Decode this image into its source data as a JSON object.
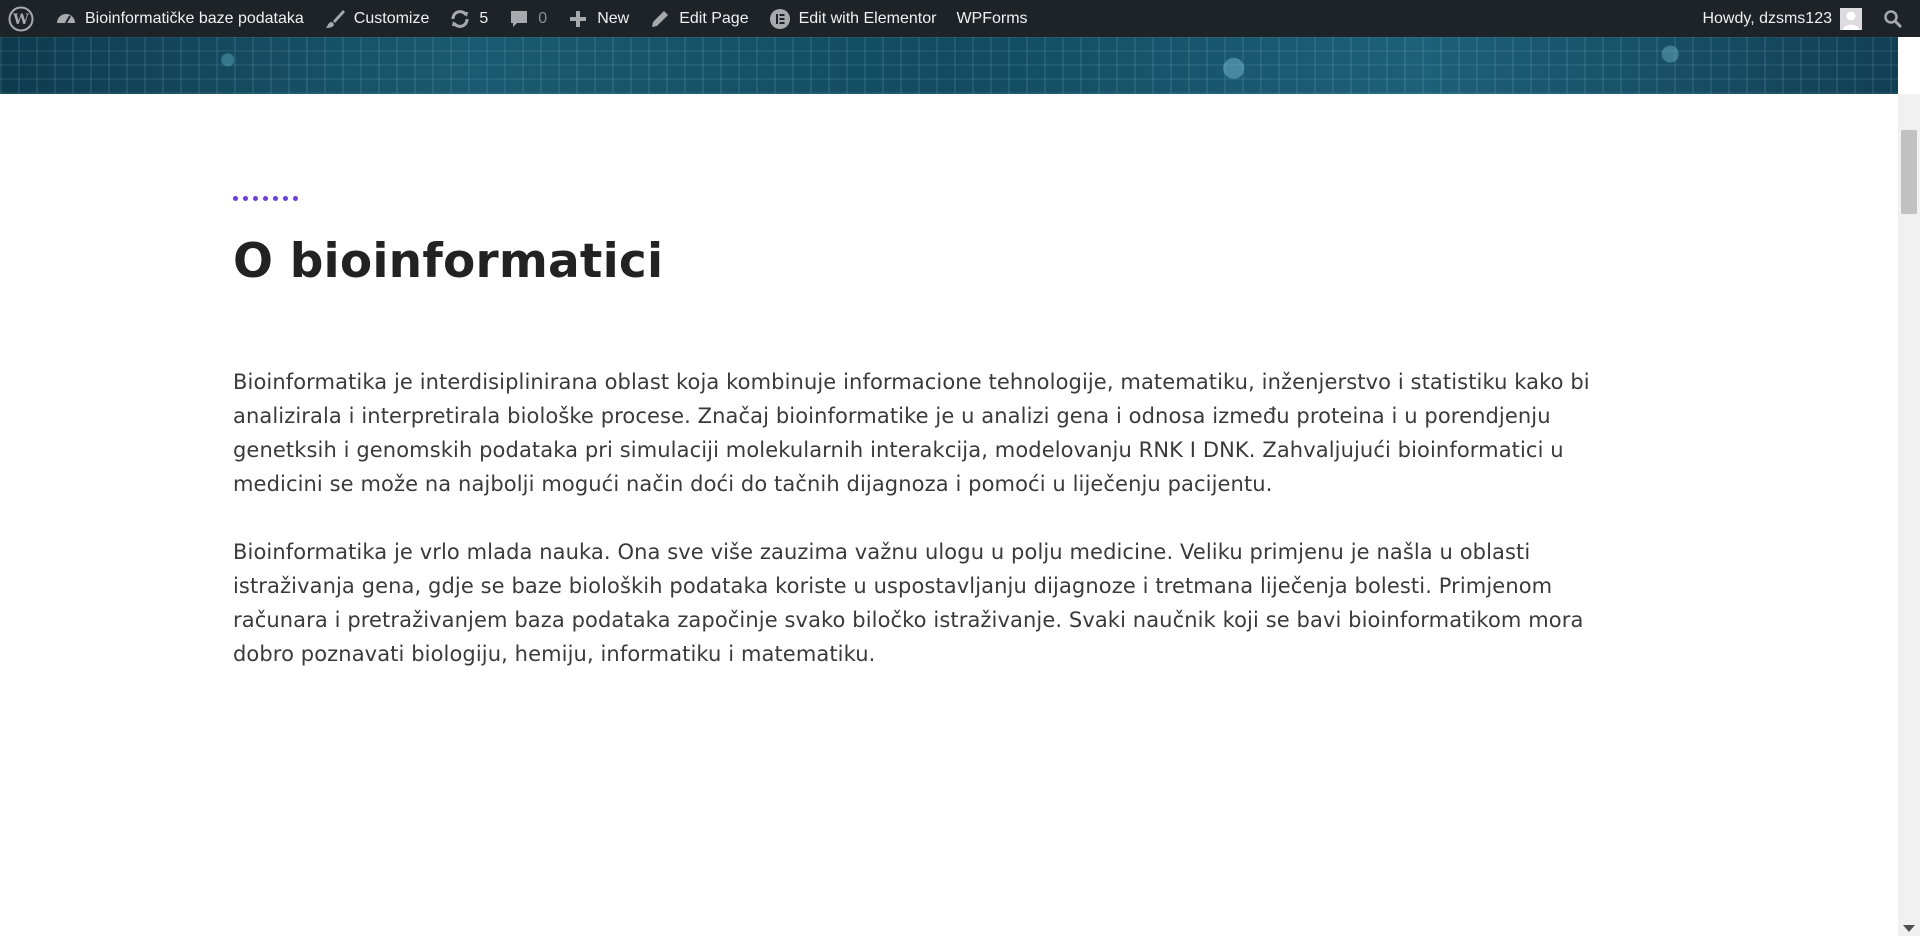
{
  "admin_bar": {
    "site_name": "Bioinformatičke baze podataka",
    "customize": "Customize",
    "updates_count": "5",
    "comments_count": "0",
    "new": "New",
    "edit_page": "Edit Page",
    "edit_elementor": "Edit with Elementor",
    "wpforms": "WPForms",
    "howdy": "Howdy, dzsms123"
  },
  "content": {
    "title": "O bioinformatici",
    "paragraphs": [
      "Bioinformatika je interdisiplinirana oblast koja kombinuje informacione tehnologije, matematiku, inženjerstvo i statistiku kako bi analizirala i interpretirala biološke procese.  Značaj bioinformatike je u analizi gena i odnosa između proteina  i u porendjenju genetksih i genomskih podataka pri simulaciji molekularnih interakcija, modelovanju RNK I DNK. Zahvaljujući bioinformatici u medicini se može na najbolji mogući način doći do tačnih dijagnoza i pomoći u liječenju pacijentu.",
      "Bioinformatika je vrlo mlada nauka. Ona sve više zauzima važnu ulogu u polju medicine. Veliku primjenu je našla u oblasti istraživanja gena, gdje se baze bioloških podataka koriste u uspostavljanju dijagnoze i tretmana liječenja bolesti. Primjenom računara i pretraživanjem baza podataka započinje svako biločko istraživanje. Svaki naučnik koji se bavi bioinformatikom mora dobro poznavati biologiju, hemiju, informatiku i matematiku."
    ]
  },
  "colors": {
    "admin_bar_bg": "#1d2327",
    "accent_dots": "#6c3fd8",
    "title": "#222222",
    "body_text": "#3a3a3a"
  },
  "icons": [
    "wordpress-icon",
    "dashboard-icon",
    "brush-icon",
    "refresh-icon",
    "comment-icon",
    "plus-icon",
    "pencil-icon",
    "elementor-icon",
    "avatar-icon",
    "search-icon"
  ]
}
